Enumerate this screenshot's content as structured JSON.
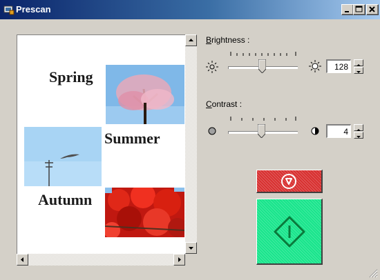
{
  "window": {
    "title": "Prescan"
  },
  "preview": {
    "captions": [
      "Spring",
      "Summer",
      "Autumn"
    ]
  },
  "brightness": {
    "label_accel": "B",
    "label_rest": "rightness :",
    "value": "128"
  },
  "contrast": {
    "label_accel": "C",
    "label_rest": "ontrast :",
    "value": "4"
  },
  "buttons": {
    "stop": "stop-button",
    "go": "start-scan-button"
  },
  "colors": {
    "titlebar_start": "#0a246a",
    "stop": "#d83030",
    "go": "#19e58c",
    "go_icon": "#0a7a3c"
  }
}
